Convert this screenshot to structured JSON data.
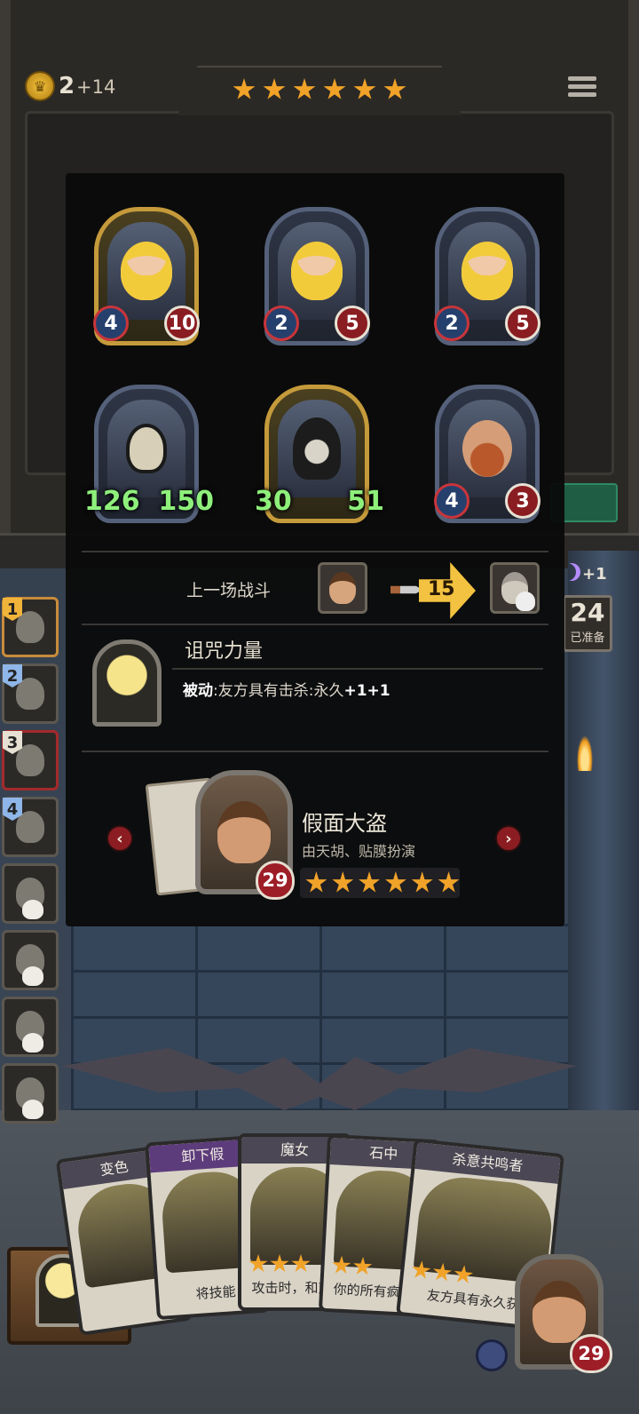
{
  "header": {
    "coins": "2",
    "coin_income": "+14",
    "tier_stars": 6
  },
  "board": {
    "top_row": [
      {
        "attack": "4",
        "health": "10",
        "frame": "gold"
      },
      {
        "attack": "2",
        "health": "5",
        "frame": "silver"
      },
      {
        "attack": "2",
        "health": "5",
        "frame": "silver"
      }
    ],
    "bottom_row": [
      {
        "attack": "126",
        "health": "150",
        "frame": "silver",
        "style": "green"
      },
      {
        "attack": "30",
        "health": "51",
        "frame": "gold",
        "style": "green"
      },
      {
        "attack": "4",
        "health": "3",
        "frame": "silver",
        "style": "normal"
      }
    ]
  },
  "last_battle": {
    "label": "上一场战斗",
    "damage": "15"
  },
  "trinket": {
    "title": "诅咒力量",
    "desc_prefix": "被动",
    "desc_body": ":友方具有击杀:永久",
    "desc_bonus": "+1+1"
  },
  "hero": {
    "name": "假面大盗",
    "voice": "由天胡、贴膜扮演",
    "health": "29",
    "stars": 6
  },
  "roster": [
    {
      "num": "1",
      "numColor": "#f0b43a",
      "state": "active"
    },
    {
      "num": "2",
      "numColor": "#8fb6e8",
      "state": "normal"
    },
    {
      "num": "3",
      "numColor": "#e7e1d3",
      "state": "enemy"
    },
    {
      "num": "4",
      "numColor": "#8fb6e8",
      "state": "normal"
    },
    {
      "num": "",
      "state": "dead"
    },
    {
      "num": "",
      "state": "dead"
    },
    {
      "num": "",
      "state": "dead"
    },
    {
      "num": "",
      "state": "dead"
    }
  ],
  "right_panel": {
    "ready_count": "24",
    "ready_label": "已准备",
    "bonus": "+1"
  },
  "hand": [
    {
      "title": "变色",
      "text": "",
      "purple": false,
      "stars": 0
    },
    {
      "title": "卸下假",
      "text": "将技能",
      "purple": true,
      "stars": 0
    },
    {
      "title": "魔女",
      "text": "攻击时，和对方",
      "purple": false,
      "stars": 3
    },
    {
      "title": "石中",
      "text": "你的所有疯狂以",
      "purple": false,
      "stars": 2
    },
    {
      "title": "杀意共鸣者",
      "text": "友方具有永久获",
      "purple": false,
      "stars": 3
    }
  ],
  "player": {
    "health": "29"
  },
  "colors": {
    "gold": "#f0a328",
    "green_stat": "#8ef07b",
    "heart": "#9d1e27"
  }
}
